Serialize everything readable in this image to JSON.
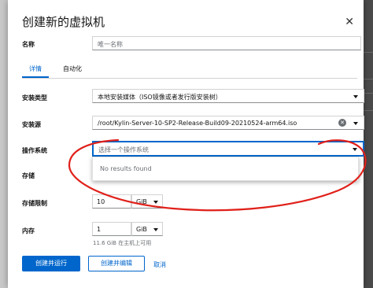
{
  "dialog": {
    "title": "创建新的虚拟机",
    "close_icon": "close-icon"
  },
  "form": {
    "name_label": "名称",
    "name_placeholder": "唯一名称",
    "tabs": [
      {
        "label": "详情",
        "active": true
      },
      {
        "label": "自动化",
        "active": false
      }
    ],
    "install_type_label": "安装类型",
    "install_type_value": "本地安装媒体（ISO镜像或者发行版安装树）",
    "install_source_label": "安装源",
    "install_source_value": "/root/Kylin-Server-10-SP2-Release-Build09-20210524-arm64.iso",
    "os_label": "操作系统",
    "os_placeholder": "选择一个操作系统",
    "os_menu_empty_text": "No results found",
    "storage_label": "存储",
    "storage_limit_label": "存储限制",
    "storage_limit_value": "10",
    "storage_limit_unit": "GiB",
    "memory_label": "内存",
    "memory_value": "1",
    "memory_unit": "GiB",
    "memory_hint": "11.6 GiB 在主机上可用"
  },
  "actions": {
    "create_and_run": "创建并运行",
    "create_and_edit": "创建并编辑",
    "cancel": "取消"
  },
  "colors": {
    "accent": "#0066cc",
    "annotation": "#e0201a"
  }
}
